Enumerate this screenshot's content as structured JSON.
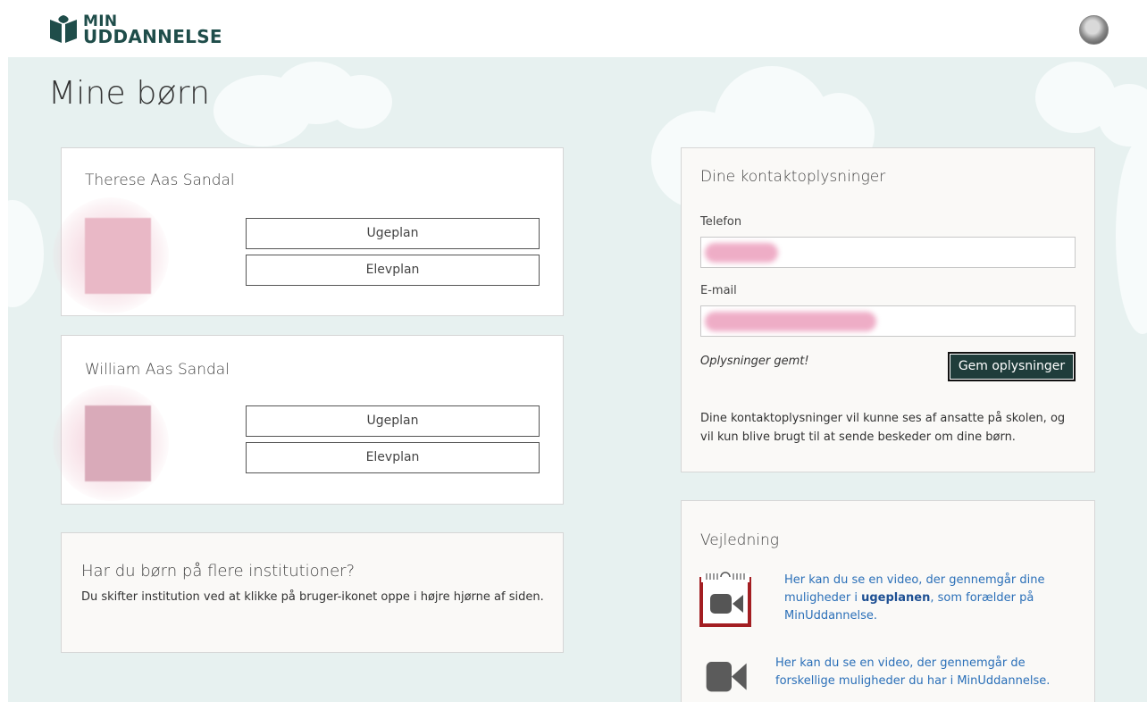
{
  "app": {
    "logo_line1": "MIN",
    "logo_line2": "UDDANNELSE"
  },
  "page": {
    "title": "Mine børn"
  },
  "children": [
    {
      "name": "Therese Aas Sandal",
      "ugeplan_label": "Ugeplan",
      "elevplan_label": "Elevplan"
    },
    {
      "name": "William Aas Sandal",
      "ugeplan_label": "Ugeplan",
      "elevplan_label": "Elevplan"
    }
  ],
  "institution_info": {
    "title": "Har du børn på flere institutioner?",
    "text": "Du skifter institution ved at klikke på bruger-ikonet oppe i højre hjørne af siden."
  },
  "contact": {
    "heading": "Dine kontaktoplysninger",
    "phone_label": "Telefon",
    "email_label": "E-mail",
    "saved_message": "Oplysninger gemt!",
    "save_button": "Gem oplysninger",
    "note": "Dine kontaktoplysninger vil kunne ses af ansatte på skolen, og vil kun blive brugt til at sende beskeder om dine børn."
  },
  "guide": {
    "heading": "Vejledning",
    "link1_pre": "Her kan du se en video, der gennemgår dine muligheder i ",
    "link1_bold": "ugeplanen",
    "link1_post": ", som forælder på MinUddannelse.",
    "link2": "Her kan du se en video, der gennemgår de forskellige muligheder du har i MinUddannelse."
  },
  "colors": {
    "brand": "#1f4d4a",
    "background": "#e7f1f0",
    "link": "#2a6fb8",
    "button_dark": "#1f3d3b"
  },
  "icons": [
    "logo-leaf-icon",
    "user-avatar-icon",
    "ugeplan-video-icon",
    "video-camera-icon"
  ]
}
